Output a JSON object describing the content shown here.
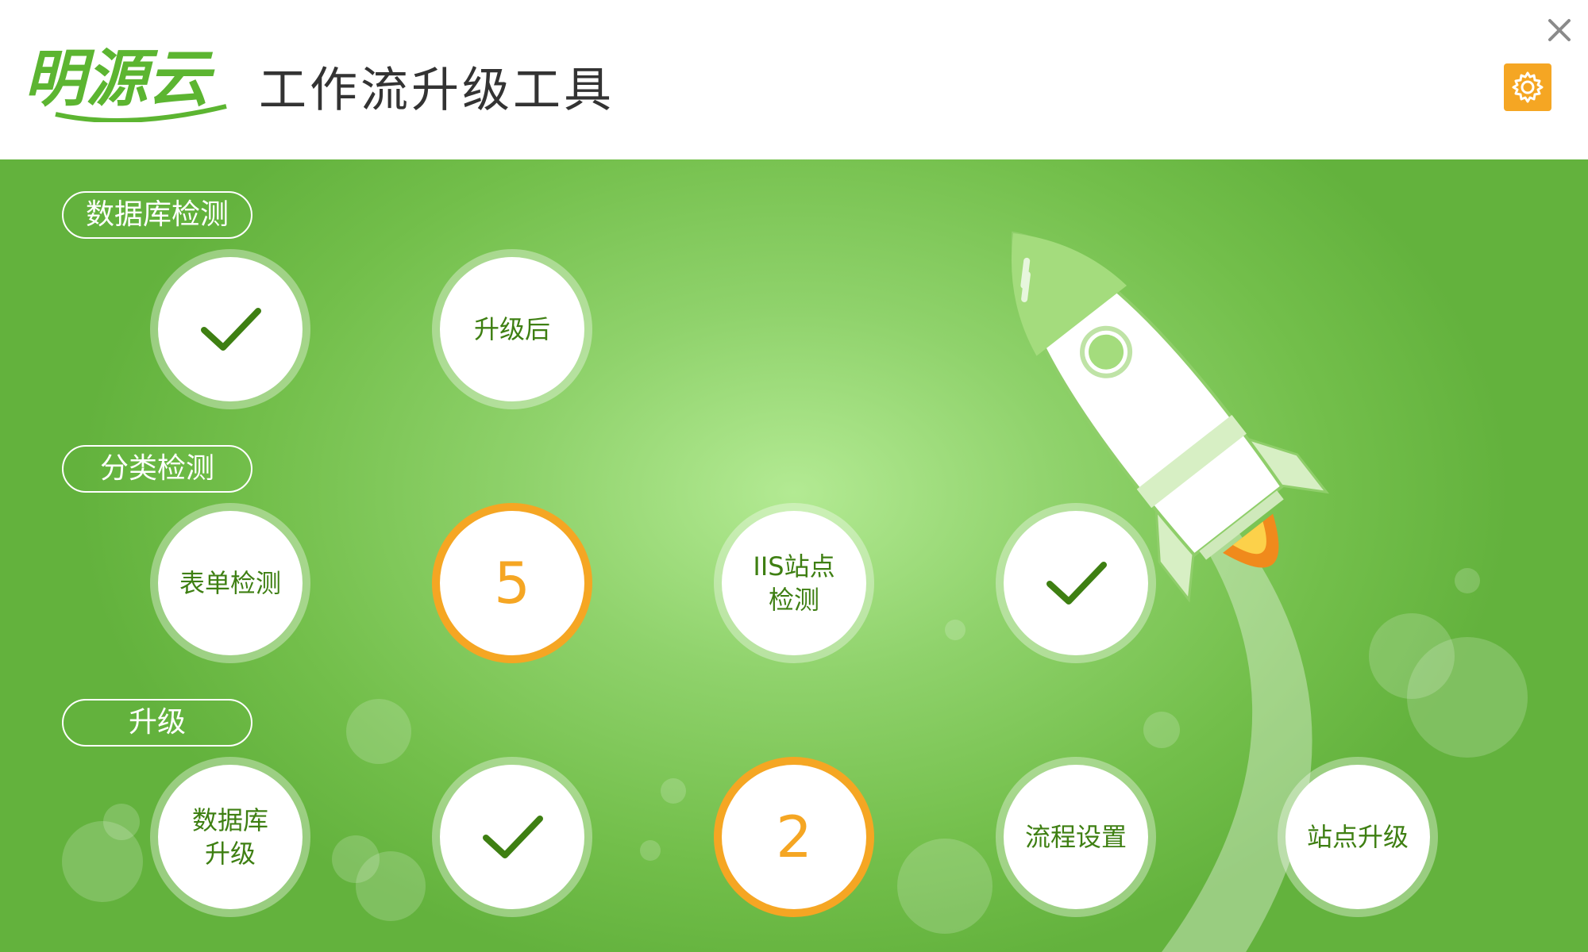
{
  "header": {
    "logo_text": "明源云",
    "title": "工作流升级工具",
    "close_icon": "close-icon",
    "settings_icon": "gear-icon"
  },
  "sections": [
    {
      "label": "数据库检测"
    },
    {
      "label": "分类检测"
    },
    {
      "label": "升级"
    }
  ],
  "steps": {
    "row1": [
      "",
      "升级后"
    ],
    "row2": [
      "表单检测",
      "5",
      "IIS站点\n检测",
      ""
    ],
    "row3": [
      "数据库\n升级",
      "",
      "2",
      "流程设置",
      "站点升级"
    ]
  },
  "colors": {
    "header_bg": "#ffffff",
    "main_green": "#7cc64f",
    "accent_orange": "#f5a623",
    "check_green": "#3e7f12",
    "logo_green": "#5cb531"
  }
}
